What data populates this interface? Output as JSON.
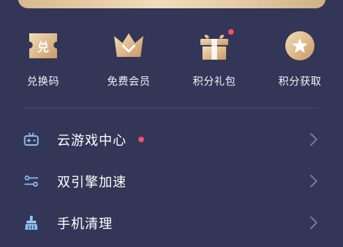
{
  "quick_actions": [
    {
      "label": "兑换码",
      "icon": "redeem-ticket-icon",
      "badge": false
    },
    {
      "label": "免费会员",
      "icon": "crown-icon",
      "badge": false
    },
    {
      "label": "积分礼包",
      "icon": "gift-box-icon",
      "badge": true
    },
    {
      "label": "积分获取",
      "icon": "star-coin-icon",
      "badge": false
    }
  ],
  "menu": [
    {
      "label": "云游戏中心",
      "icon": "gamepad-icon",
      "dot": true
    },
    {
      "label": "双引擎加速",
      "icon": "dual-engine-icon",
      "dot": false
    },
    {
      "label": "手机清理",
      "icon": "broom-icon",
      "dot": false
    }
  ],
  "colors": {
    "background": "#343657",
    "gold_light": "#f1dcbc",
    "gold_dark": "#c9a171",
    "badge_red": "#f0526a",
    "menu_icon_blue": "#8ec3f4"
  }
}
